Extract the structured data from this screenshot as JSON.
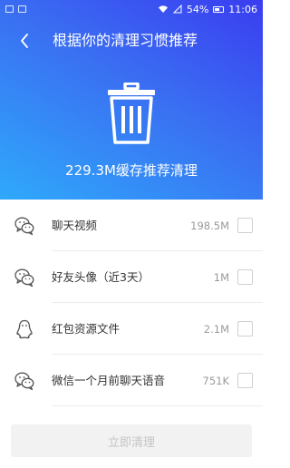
{
  "status_bar": {
    "battery": "54%",
    "time": "11:06"
  },
  "header": {
    "title": "根据你的清理习惯推荐"
  },
  "summary": {
    "text": "229.3M缓存推荐清理"
  },
  "items": [
    {
      "label": "聊天视频",
      "size": "198.5M",
      "icon": "chat-icon",
      "checked": false
    },
    {
      "label": "好友头像（近3天）",
      "size": "1M",
      "icon": "chat-icon",
      "checked": false
    },
    {
      "label": "红包资源文件",
      "size": "2.1M",
      "icon": "penguin-icon",
      "checked": false
    },
    {
      "label": "微信一个月前聊天语音",
      "size": "751K",
      "icon": "chat-icon",
      "checked": false
    }
  ],
  "footer": {
    "clean_button": "立即清理"
  },
  "colors": {
    "gradient_top": "#3a3df0",
    "gradient_bottom": "#2fa9fb",
    "button_disabled": "#f2f2f2"
  }
}
